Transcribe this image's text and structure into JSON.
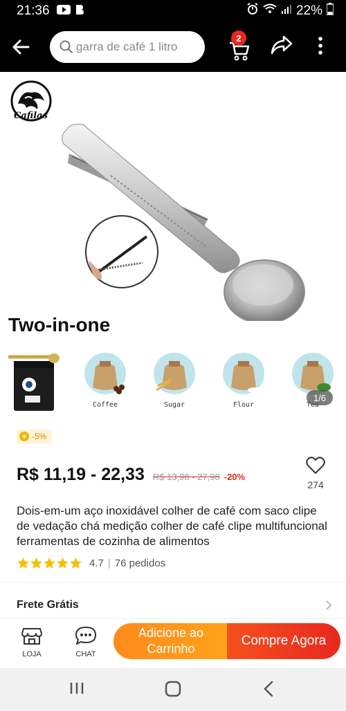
{
  "status_bar": {
    "time": "21:36",
    "battery": "22%"
  },
  "header": {
    "search_placeholder": "garra de café 1 litro",
    "cart_count": "2"
  },
  "gallery": {
    "brand": "Cafilas",
    "headline": "Two-in-one",
    "variants": [
      "Coffee",
      "Sugar",
      "Flour",
      "Tea"
    ],
    "counter": "1/6"
  },
  "product": {
    "discount_badge": "-5%",
    "price": "R$ 11,19 - 22,33",
    "old_price": "R$ 13,98 - 27,98",
    "discount_pct": "-20%",
    "wishlist_count": "274",
    "title": "Dois-em-um aço inoxidável colher de café com saco clipe de vedação chá medição colher de café clipe multifuncional ferramentas de cozinha de alimentos",
    "rating": "4.7",
    "orders": "76 pedidos",
    "star_count": 5
  },
  "shipping": {
    "label": "Frete Grátis"
  },
  "actions": {
    "store_label": "LOJA",
    "chat_label": "CHAT",
    "add_to_cart": "Adicione ao Carrinho",
    "buy_now": "Compre Agora"
  },
  "colors": {
    "accent_red": "#e8281e",
    "accent_orange": "#ff8a1c",
    "header_bg": "#000000"
  },
  "icons": [
    "back-arrow-icon",
    "search-icon",
    "cart-icon",
    "share-icon",
    "more-vertical-icon",
    "heart-icon",
    "star-icon",
    "store-icon",
    "chat-icon",
    "chevron-right-icon",
    "recents-icon",
    "home-icon",
    "back-icon"
  ]
}
